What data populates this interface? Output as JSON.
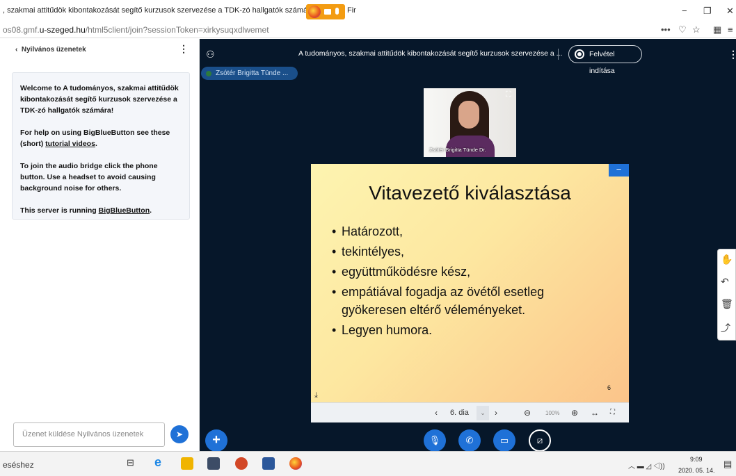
{
  "window": {
    "title": ", szakmai attitűdök kibontakozását segítő kurzusok szervezése a TDK-zó hallgatók számára - Mozilla Fir",
    "minimize": "−",
    "maximize": "❐",
    "close": "✕"
  },
  "urlbar": {
    "url_prefix": "os08.gmf.",
    "url_domain": "u-szeged.hu",
    "url_suffix": "/html5client/join?sessionToken=xirkysuqxdlwemet"
  },
  "chat": {
    "header": "Nyilvános üzenetek",
    "welcome_line1_prefix": "Welcome to ",
    "welcome_line1_title": "A tudományos, szakmai attitűdök kibontakozását segítő kurzusok szervezése a TDK-zó hallgatók számára!",
    "help_prefix": "For help on using BigBlueButton see these (short) ",
    "help_link": "tutorial videos",
    "help_suffix": ".",
    "audio_text": "To join the audio bridge click the phone button. Use a headset to avoid causing background noise for others.",
    "server_prefix": "This server is running ",
    "server_link": "BigBlueButton",
    "server_suffix": ".",
    "input_placeholder": "Üzenet küldése Nyilvános üzenetek"
  },
  "meeting": {
    "title": "A tudományos, szakmai attitűdök kibontakozását segítő kurzusok szervezése a ...",
    "record_label": "Felvétel indítása",
    "talker": "Zsótér Brigitta Tünde ..."
  },
  "webcam": {
    "name": "Zsótér Brigitta Tünde Dr."
  },
  "slide": {
    "title": "Vitavezető kiválasztása",
    "bullets": [
      "Határozott,",
      " tekintélyes,",
      " együttműködésre kész,",
      " empátiával fogadja az övétől esetleg gyökeresen eltérő véleményeket.",
      "Legyen humora."
    ],
    "page_number": "6"
  },
  "slide_toolbar": {
    "current_slide": "6. dia",
    "zoom": "100%"
  },
  "taskbar": {
    "left_text": "eséshez",
    "time": "9:09",
    "date": "2020. 05. 14."
  },
  "colors": {
    "accent": "#1f71d7",
    "main_bg": "#06172a"
  }
}
